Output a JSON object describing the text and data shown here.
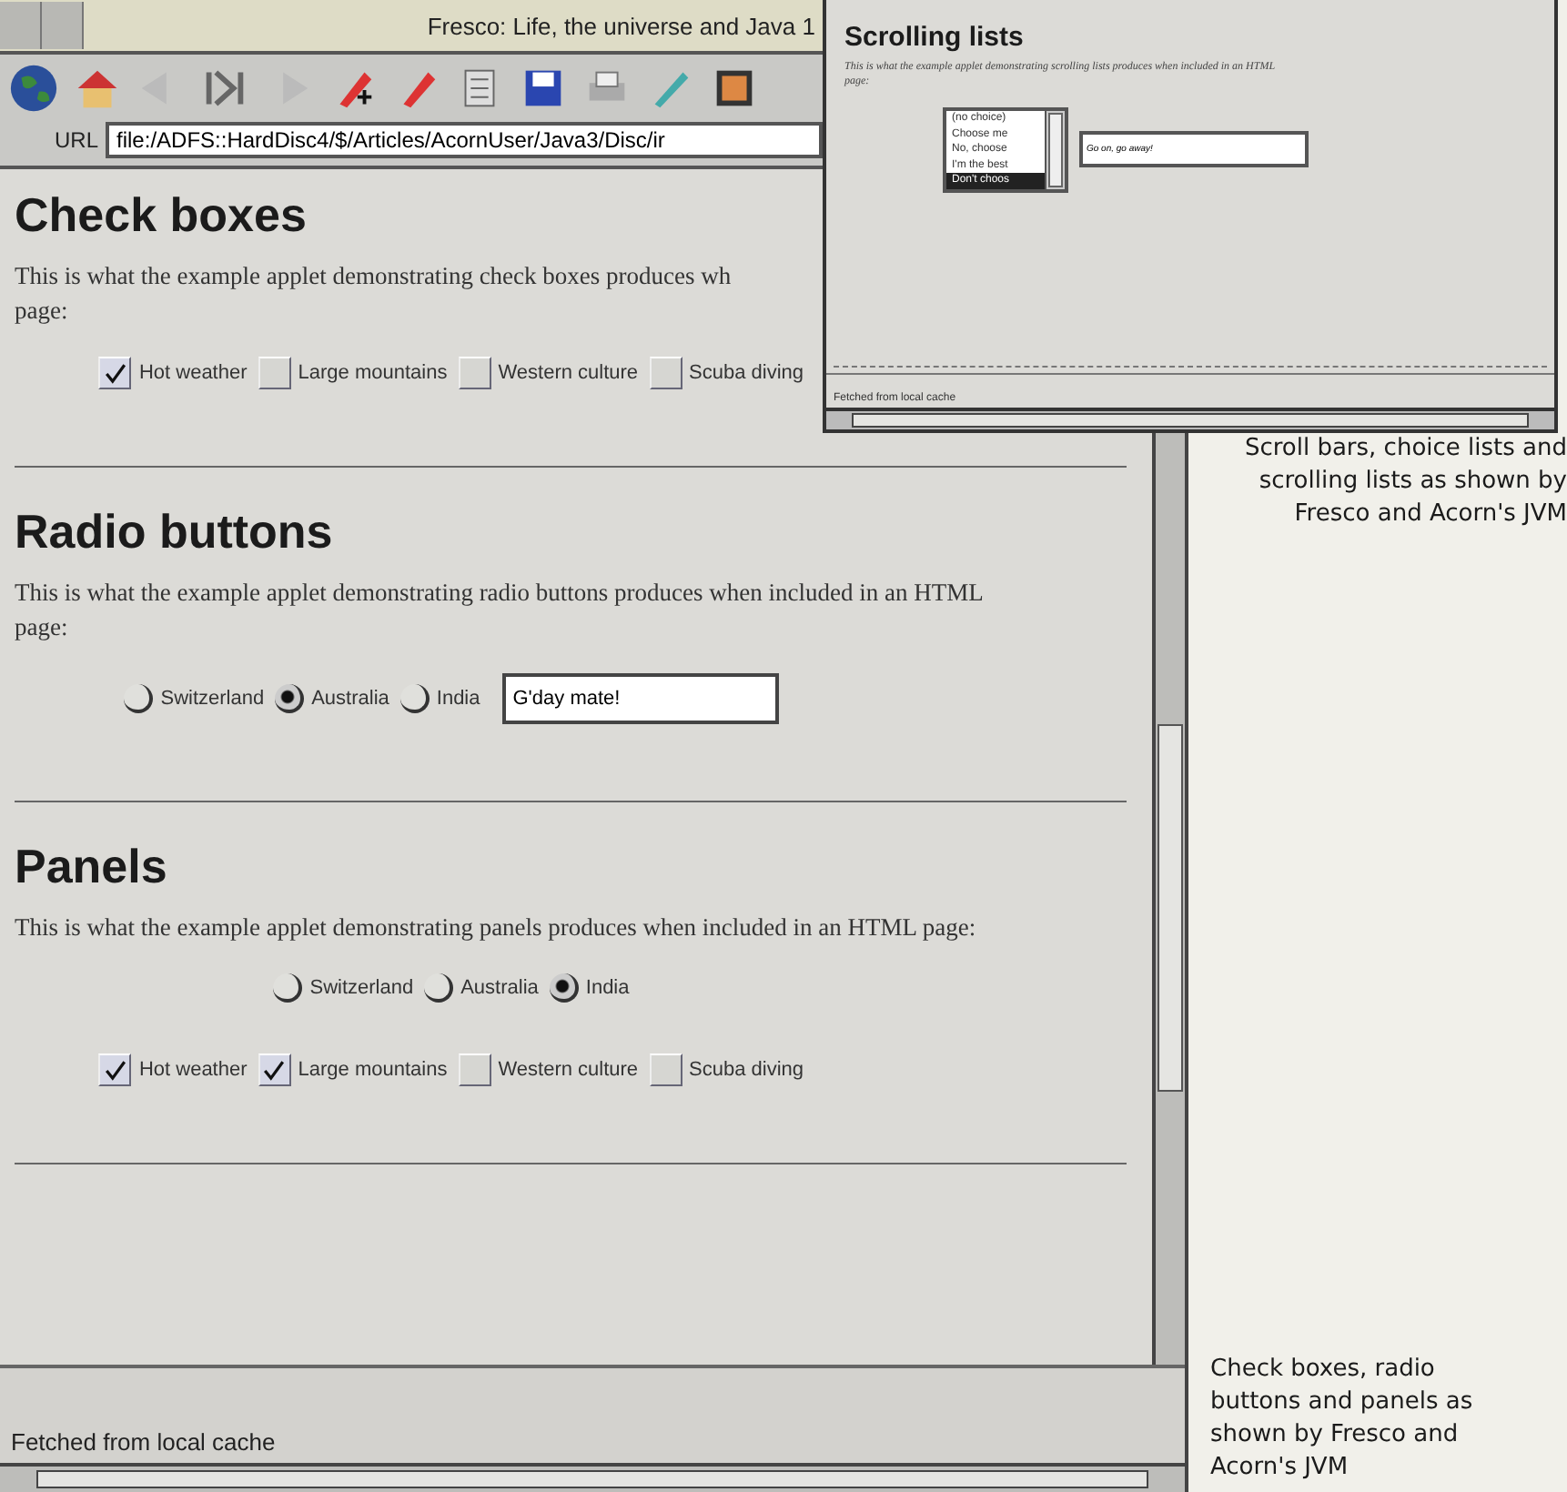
{
  "main_window": {
    "title": "Fresco: Life, the universe and Java 1",
    "url_label": "URL",
    "url": "file:/ADFS::HardDisc4/$/Articles/AcornUser/Java3/Disc/ir",
    "sections": [
      {
        "heading": "Check boxes",
        "lines": [
          "This is what the example applet demonstrating check boxes produces wh",
          "page:"
        ],
        "rows": [
          {
            "kind": "checkboxes",
            "items": [
              {
                "label": "Hot weather",
                "checked": true
              },
              {
                "label": "Large mountains",
                "checked": false
              },
              {
                "label": "Western culture",
                "checked": false
              },
              {
                "label": "Scuba diving",
                "checked": false
              }
            ]
          }
        ]
      },
      {
        "heading": "Radio buttons",
        "lines": [
          "This is what the example applet demonstrating radio buttons produces when included in an HTML",
          "page:"
        ],
        "rows": [
          {
            "kind": "radios",
            "items": [
              {
                "label": "Switzerland",
                "selected": false
              },
              {
                "label": "Australia",
                "selected": true
              },
              {
                "label": "India",
                "selected": false
              }
            ],
            "field": "G'day mate!"
          }
        ]
      },
      {
        "heading": "Panels",
        "lines": [
          "This is what the example applet demonstrating panels produces when included in an HTML page:"
        ],
        "rows": [
          {
            "kind": "radios",
            "items": [
              {
                "label": "Switzerland",
                "selected": false
              },
              {
                "label": "Australia",
                "selected": false
              },
              {
                "label": "India",
                "selected": true
              }
            ]
          },
          {
            "kind": "checkboxes",
            "items": [
              {
                "label": "Hot weather",
                "checked": true
              },
              {
                "label": "Large mountains",
                "checked": true
              },
              {
                "label": "Western culture",
                "checked": false
              },
              {
                "label": "Scuba diving",
                "checked": false
              }
            ]
          }
        ]
      }
    ],
    "status": "Fetched from local cache"
  },
  "second_window": {
    "heading": "Scrolling lists",
    "lines": [
      "This is what the example applet demonstrating scrolling lists produces when included in an HTML",
      "page:"
    ],
    "list": [
      {
        "label": "(no choice)",
        "selected": false
      },
      {
        "label": "Choose me",
        "selected": false
      },
      {
        "label": "No, choose",
        "selected": false
      },
      {
        "label": "I'm the best",
        "selected": false
      },
      {
        "label": "Don't choos",
        "selected": true
      }
    ],
    "field": "Go on, go away!",
    "status": "Fetched from local cache"
  },
  "captions": [
    "Scroll bars, choice lists and scrolling lists as shown by Fresco and Acorn's JVM",
    "Check boxes, radio buttons and panels as shown by Fresco and Acorn's JVM"
  ]
}
